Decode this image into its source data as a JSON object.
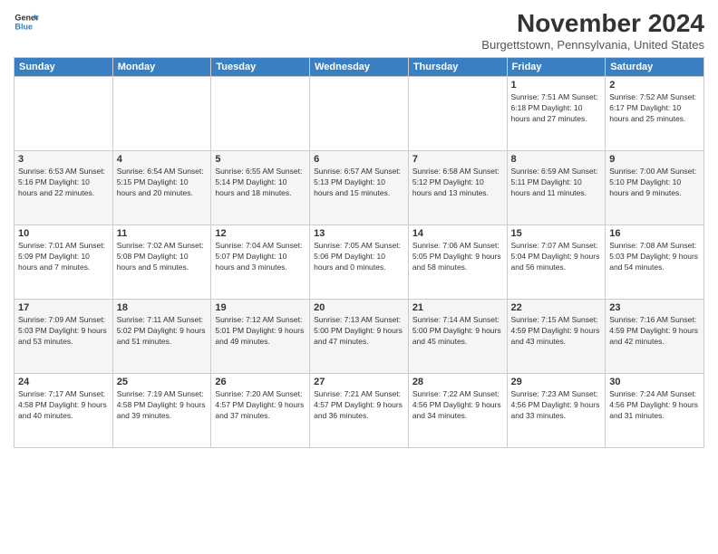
{
  "logo": {
    "line1": "General",
    "line2": "Blue"
  },
  "title": "November 2024",
  "subtitle": "Burgettstown, Pennsylvania, United States",
  "days_header": [
    "Sunday",
    "Monday",
    "Tuesday",
    "Wednesday",
    "Thursday",
    "Friday",
    "Saturday"
  ],
  "weeks": [
    [
      {
        "day": "",
        "info": ""
      },
      {
        "day": "",
        "info": ""
      },
      {
        "day": "",
        "info": ""
      },
      {
        "day": "",
        "info": ""
      },
      {
        "day": "",
        "info": ""
      },
      {
        "day": "1",
        "info": "Sunrise: 7:51 AM\nSunset: 6:18 PM\nDaylight: 10 hours\nand 27 minutes."
      },
      {
        "day": "2",
        "info": "Sunrise: 7:52 AM\nSunset: 6:17 PM\nDaylight: 10 hours\nand 25 minutes."
      }
    ],
    [
      {
        "day": "3",
        "info": "Sunrise: 6:53 AM\nSunset: 5:16 PM\nDaylight: 10 hours\nand 22 minutes."
      },
      {
        "day": "4",
        "info": "Sunrise: 6:54 AM\nSunset: 5:15 PM\nDaylight: 10 hours\nand 20 minutes."
      },
      {
        "day": "5",
        "info": "Sunrise: 6:55 AM\nSunset: 5:14 PM\nDaylight: 10 hours\nand 18 minutes."
      },
      {
        "day": "6",
        "info": "Sunrise: 6:57 AM\nSunset: 5:13 PM\nDaylight: 10 hours\nand 15 minutes."
      },
      {
        "day": "7",
        "info": "Sunrise: 6:58 AM\nSunset: 5:12 PM\nDaylight: 10 hours\nand 13 minutes."
      },
      {
        "day": "8",
        "info": "Sunrise: 6:59 AM\nSunset: 5:11 PM\nDaylight: 10 hours\nand 11 minutes."
      },
      {
        "day": "9",
        "info": "Sunrise: 7:00 AM\nSunset: 5:10 PM\nDaylight: 10 hours\nand 9 minutes."
      }
    ],
    [
      {
        "day": "10",
        "info": "Sunrise: 7:01 AM\nSunset: 5:09 PM\nDaylight: 10 hours\nand 7 minutes."
      },
      {
        "day": "11",
        "info": "Sunrise: 7:02 AM\nSunset: 5:08 PM\nDaylight: 10 hours\nand 5 minutes."
      },
      {
        "day": "12",
        "info": "Sunrise: 7:04 AM\nSunset: 5:07 PM\nDaylight: 10 hours\nand 3 minutes."
      },
      {
        "day": "13",
        "info": "Sunrise: 7:05 AM\nSunset: 5:06 PM\nDaylight: 10 hours\nand 0 minutes."
      },
      {
        "day": "14",
        "info": "Sunrise: 7:06 AM\nSunset: 5:05 PM\nDaylight: 9 hours\nand 58 minutes."
      },
      {
        "day": "15",
        "info": "Sunrise: 7:07 AM\nSunset: 5:04 PM\nDaylight: 9 hours\nand 56 minutes."
      },
      {
        "day": "16",
        "info": "Sunrise: 7:08 AM\nSunset: 5:03 PM\nDaylight: 9 hours\nand 54 minutes."
      }
    ],
    [
      {
        "day": "17",
        "info": "Sunrise: 7:09 AM\nSunset: 5:03 PM\nDaylight: 9 hours\nand 53 minutes."
      },
      {
        "day": "18",
        "info": "Sunrise: 7:11 AM\nSunset: 5:02 PM\nDaylight: 9 hours\nand 51 minutes."
      },
      {
        "day": "19",
        "info": "Sunrise: 7:12 AM\nSunset: 5:01 PM\nDaylight: 9 hours\nand 49 minutes."
      },
      {
        "day": "20",
        "info": "Sunrise: 7:13 AM\nSunset: 5:00 PM\nDaylight: 9 hours\nand 47 minutes."
      },
      {
        "day": "21",
        "info": "Sunrise: 7:14 AM\nSunset: 5:00 PM\nDaylight: 9 hours\nand 45 minutes."
      },
      {
        "day": "22",
        "info": "Sunrise: 7:15 AM\nSunset: 4:59 PM\nDaylight: 9 hours\nand 43 minutes."
      },
      {
        "day": "23",
        "info": "Sunrise: 7:16 AM\nSunset: 4:59 PM\nDaylight: 9 hours\nand 42 minutes."
      }
    ],
    [
      {
        "day": "24",
        "info": "Sunrise: 7:17 AM\nSunset: 4:58 PM\nDaylight: 9 hours\nand 40 minutes."
      },
      {
        "day": "25",
        "info": "Sunrise: 7:19 AM\nSunset: 4:58 PM\nDaylight: 9 hours\nand 39 minutes."
      },
      {
        "day": "26",
        "info": "Sunrise: 7:20 AM\nSunset: 4:57 PM\nDaylight: 9 hours\nand 37 minutes."
      },
      {
        "day": "27",
        "info": "Sunrise: 7:21 AM\nSunset: 4:57 PM\nDaylight: 9 hours\nand 36 minutes."
      },
      {
        "day": "28",
        "info": "Sunrise: 7:22 AM\nSunset: 4:56 PM\nDaylight: 9 hours\nand 34 minutes."
      },
      {
        "day": "29",
        "info": "Sunrise: 7:23 AM\nSunset: 4:56 PM\nDaylight: 9 hours\nand 33 minutes."
      },
      {
        "day": "30",
        "info": "Sunrise: 7:24 AM\nSunset: 4:56 PM\nDaylight: 9 hours\nand 31 minutes."
      }
    ]
  ]
}
